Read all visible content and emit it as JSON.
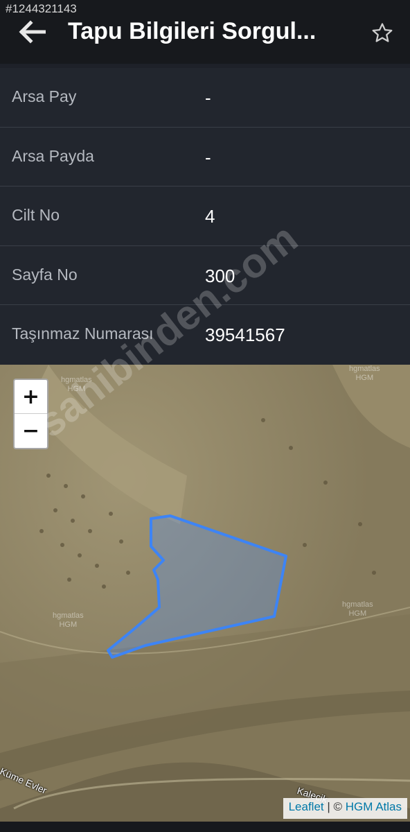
{
  "listing_id": "#1244321143",
  "header": {
    "title": "Tapu Bilgileri Sorgul...",
    "back_icon": "arrow-left-icon",
    "favorite_icon": "star-outline-icon"
  },
  "info_rows": [
    {
      "label": "Arsa Pay",
      "value": "-"
    },
    {
      "label": "Arsa Payda",
      "value": "-"
    },
    {
      "label": "Cilt No",
      "value": "4"
    },
    {
      "label": "Sayfa No",
      "value": "300"
    },
    {
      "label": "Taşınmaz Numarası",
      "value": "39541567"
    }
  ],
  "map": {
    "zoom_in_label": "+",
    "zoom_out_label": "−",
    "tile_labels": [
      "hgmatlas\nHGM",
      "hgmatlas\nHGM",
      "hgmatlas\nHGM",
      "hgmatlas\nHGM"
    ],
    "road_labels": [
      "Küme Evler",
      "Kalecik"
    ],
    "attribution": {
      "leaflet": "Leaflet",
      "separator": " | © ",
      "provider": "HGM Atlas"
    },
    "parcel_color": "#3d84f5"
  },
  "watermark": "sahibinden.com"
}
